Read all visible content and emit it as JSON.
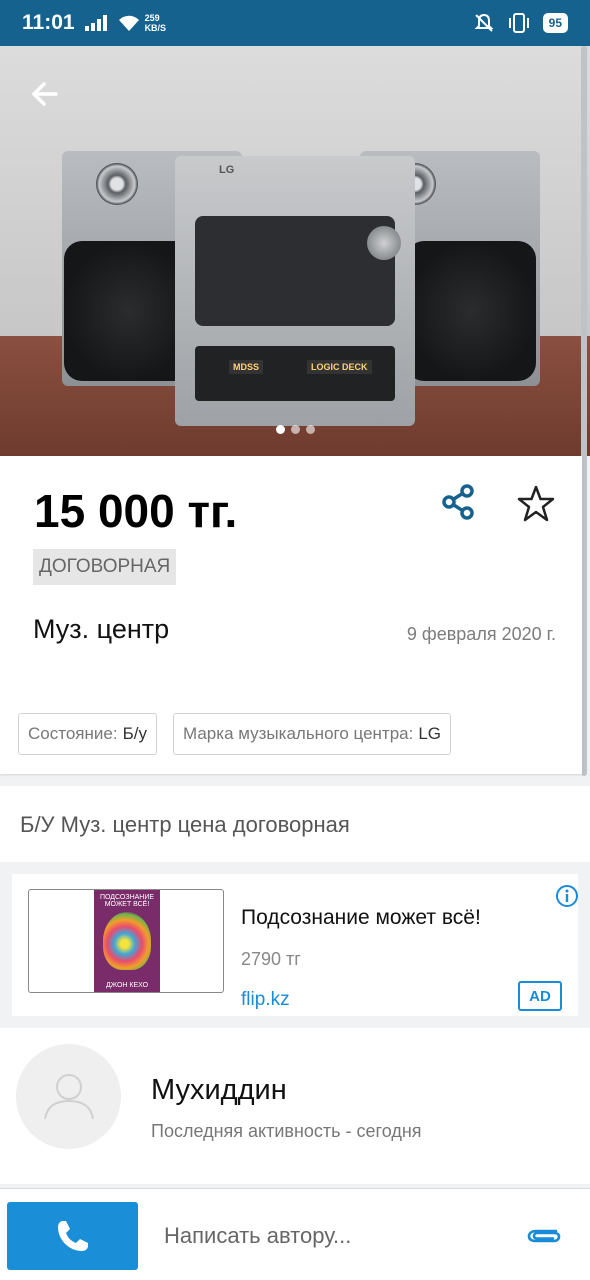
{
  "status_bar": {
    "time": "11:01",
    "net_speed_value": "259",
    "net_speed_unit": "KB/S",
    "battery": "95"
  },
  "listing": {
    "price": "15 000 тг.",
    "negotiable": "ДОГОВОРНАЯ",
    "title": "Муз. центр",
    "date": "9 февраля 2020 г.",
    "photo_count": 3,
    "active_photo": 1,
    "attributes": [
      {
        "label": "Состояние:",
        "value": "Б/у"
      },
      {
        "label": "Марка музыкального центра:",
        "value": "LG"
      }
    ],
    "description": "Б/У Муз. центр цена договорная",
    "photo_labels": {
      "brand": "LG",
      "deck_left": "MDSS",
      "deck_right": "LOGIC DECK"
    }
  },
  "ad": {
    "title": "Подсознание может всё!",
    "price": "2790 тг",
    "source": "flip.kz",
    "badge": "AD",
    "book_title": "ПОДСОЗНАНИЕ МОЖЕТ ВСЁ!",
    "book_author": "ДЖОН КЕХО"
  },
  "seller": {
    "name": "Мухиддин",
    "activity": "Последняя активность - сегодня"
  },
  "bottom_bar": {
    "message_placeholder": "Написать автору..."
  },
  "colors": {
    "status_bar": "#16628f",
    "accent": "#1b8ed8",
    "link": "#1a8bd6"
  },
  "icons": [
    "back-arrow-icon",
    "share-icon",
    "star-icon",
    "info-icon",
    "user-icon",
    "phone-icon",
    "paperclip-icon",
    "wifi-icon",
    "vibrate-icon",
    "mute-icon"
  ]
}
